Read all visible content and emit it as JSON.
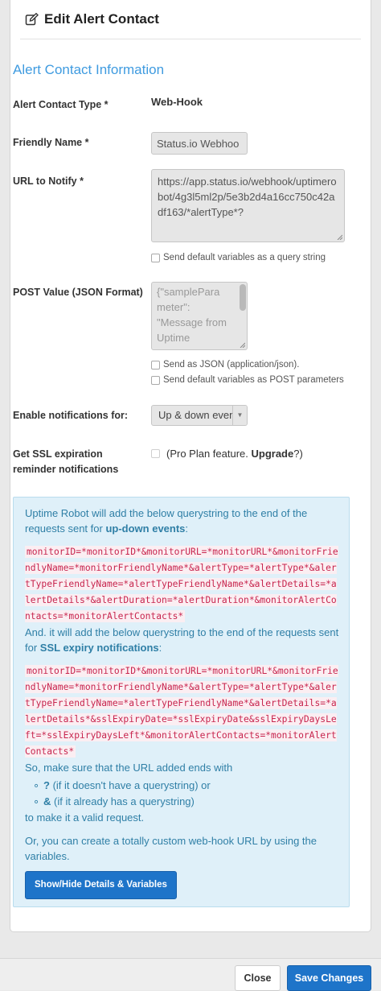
{
  "modal": {
    "title": "Edit Alert Contact",
    "section_title": "Alert Contact Information"
  },
  "form": {
    "type_label": "Alert Contact Type *",
    "type_value": "Web-Hook",
    "friendly_label": "Friendly Name *",
    "friendly_value": "Status.io Webhoo",
    "url_label": "URL to Notify *",
    "url_value": "https://app.status.io/webhook/uptimerobot/4g3l5ml2p/5e3b2d4a16cc750c42adf163/*alertType*?",
    "send_query_label": "Send default variables as a query string",
    "post_label": "POST Value (JSON Format)",
    "post_lines": [
      "{\"samplePara",
      "meter\":",
      "\"Message from",
      "Uptime"
    ],
    "send_json_label": "Send as JSON (application/json).",
    "send_post_label": "Send default variables as POST parameters",
    "notify_label": "Enable notifications for:",
    "notify_value": "Up & down events",
    "ssl_label_line1": "Get SSL expiration",
    "ssl_label_line2": "reminder notifications",
    "ssl_text_before": "(Pro Plan feature. ",
    "ssl_upgrade": "Upgrade",
    "ssl_text_after": "?)"
  },
  "info": {
    "intro_before": "Uptime Robot will add the below querystring to the end of the requests sent for ",
    "intro_bold": "up-down events",
    "intro_after": ":",
    "updown_query": "monitorID=*monitorID*&monitorURL=*monitorURL*&monitorFriendlyName=*monitorFriendlyName*&alertType=*alertType*&alertTypeFriendlyName=*alertTypeFriendlyName*&alertDetails=*alertDetails*&alertDuration=*alertDuration*&monitorAlertContacts=*monitorAlertContacts*",
    "ssl_before": "And. it will add the below querystring to the end of the requests sent for ",
    "ssl_bold": "SSL expiry notifications",
    "ssl_after": ":",
    "ssl_query": "monitorID=*monitorID*&monitorURL=*monitorURL*&monitorFriendlyName=*monitorFriendlyName*&alertType=*alertType*&alertTypeFriendlyName=*alertTypeFriendlyName*&alertDetails=*alertDetails*&sslExpiryDate=*sslExpiryDate&sslExpiryDaysLeft=*sslExpiryDaysLeft*&monitorAlertContacts=*monitorAlertContacts*",
    "ends_with": "So, make sure that the URL added ends with",
    "bullet1_sym": "?",
    "bullet1_text": " (if it doesn't have a querystring) or",
    "bullet2_sym": "&",
    "bullet2_text": " (if it already has a querystring)",
    "valid": "to make it a valid request.",
    "custom": "Or, you can create a totally custom web-hook URL by using the variables.",
    "toggle_button": "Show/Hide Details & Variables"
  },
  "footer": {
    "close": "Close",
    "save": "Save Changes"
  },
  "colors": {
    "accent": "#3f9be0",
    "primary_button": "#1e74c9",
    "info_bg": "#dff0f9",
    "code_text": "#c7254e"
  }
}
